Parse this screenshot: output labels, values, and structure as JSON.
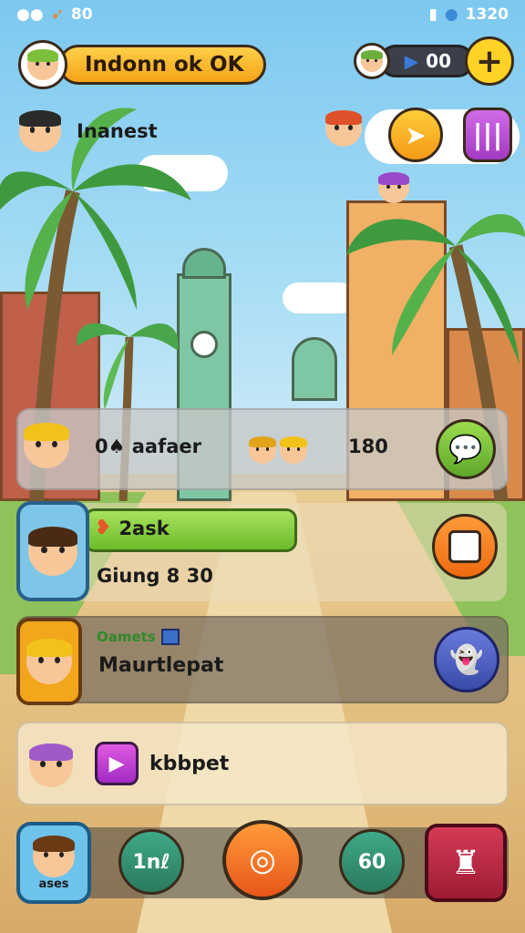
{
  "status_bar": {
    "left_value": "80",
    "right_value": "1320"
  },
  "header": {
    "title": "Indonn ok OK",
    "subtitle": "Inanest"
  },
  "currency": {
    "amount": "00"
  },
  "row1": {
    "label": "0♠ aafaer",
    "value": "180"
  },
  "row2": {
    "task_label": "2ask",
    "counter": "Giung 8 30"
  },
  "row3": {
    "tag": "Oamets",
    "title": "Maurtlepat"
  },
  "row4": {
    "title": "kbbpet"
  },
  "bottom_nav": {
    "profile_label": "ases",
    "btn1_label": "1nℓ",
    "btn3_label": "60"
  },
  "colors": {
    "gold": "#f5a316",
    "green": "#7cc63a",
    "orange": "#f27a1a",
    "purple": "#b24ad1",
    "teal": "#2f8f6f",
    "crimson": "#b8243b"
  }
}
